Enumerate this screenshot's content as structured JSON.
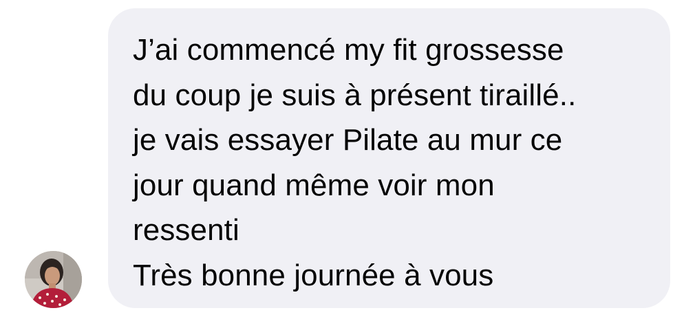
{
  "message": {
    "lines": [
      "J’ai commencé my fit grossesse",
      "du coup je suis à présent tiraillé..",
      "je vais essayer Pilate au mur ce",
      "jour quand même voir mon",
      "ressenti",
      "Très bonne journée à vous"
    ]
  },
  "colors": {
    "bubble_background": "#f0f0f5",
    "text": "#050505",
    "page_background": "#ffffff"
  },
  "icons": {
    "avatar": "sender-avatar-photo"
  }
}
